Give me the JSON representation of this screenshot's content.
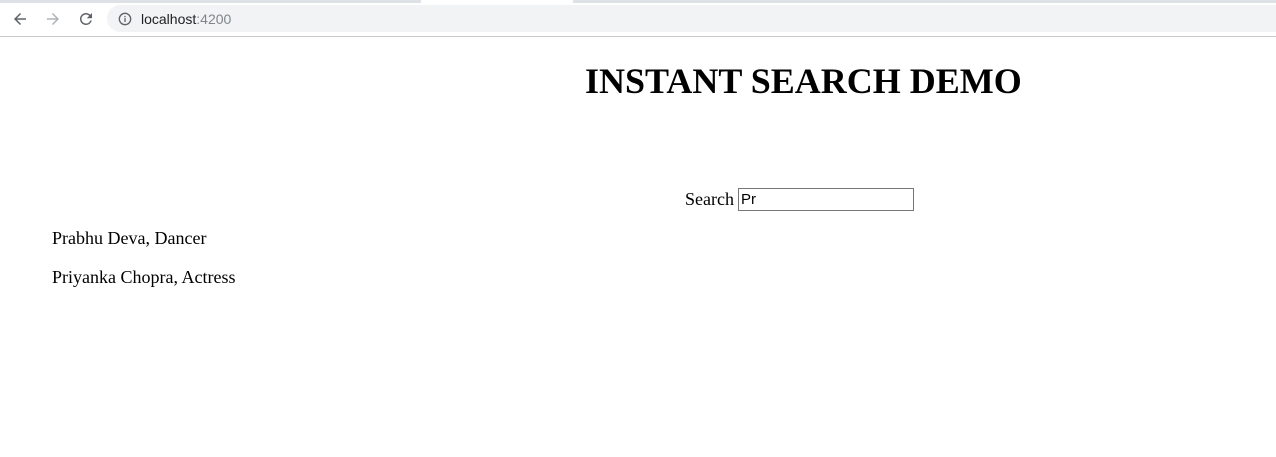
{
  "browser": {
    "url_host": "localhost",
    "url_port": ":4200"
  },
  "page": {
    "title": "INSTANT SEARCH DEMO",
    "search": {
      "label": "Search",
      "value": "Pr",
      "placeholder": ""
    },
    "results": [
      {
        "text": "Prabhu Deva, Dancer"
      },
      {
        "text": "Priyanka Chopra, Actress"
      }
    ]
  }
}
